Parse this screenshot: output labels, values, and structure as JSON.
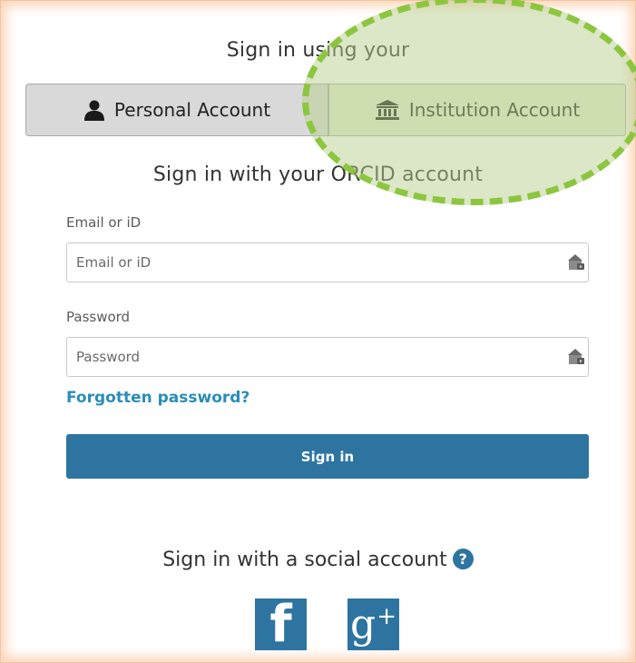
{
  "header": {
    "title": "Sign in using your"
  },
  "tabs": [
    {
      "label": "Personal Account",
      "icon": "person-icon"
    },
    {
      "label": "Institution Account",
      "icon": "institution-icon"
    }
  ],
  "orcid": {
    "title": "Sign in with your ORCID account"
  },
  "form": {
    "email_label": "Email or iD",
    "email_placeholder": "Email or iD",
    "email_value": "",
    "password_label": "Password",
    "password_placeholder": "Password",
    "password_value": "",
    "forgot_link": "Forgotten password?",
    "submit_label": "Sign in"
  },
  "social": {
    "title": "Sign in with a social account",
    "help_icon": "?",
    "facebook_glyph": "f",
    "google_glyph": "g",
    "google_plus": "+"
  },
  "colors": {
    "brand_blue": "#2d74a1",
    "link_blue": "#2a8db8",
    "highlight_green": "#8cc63f",
    "frame_peach": "#fbd7bb"
  }
}
